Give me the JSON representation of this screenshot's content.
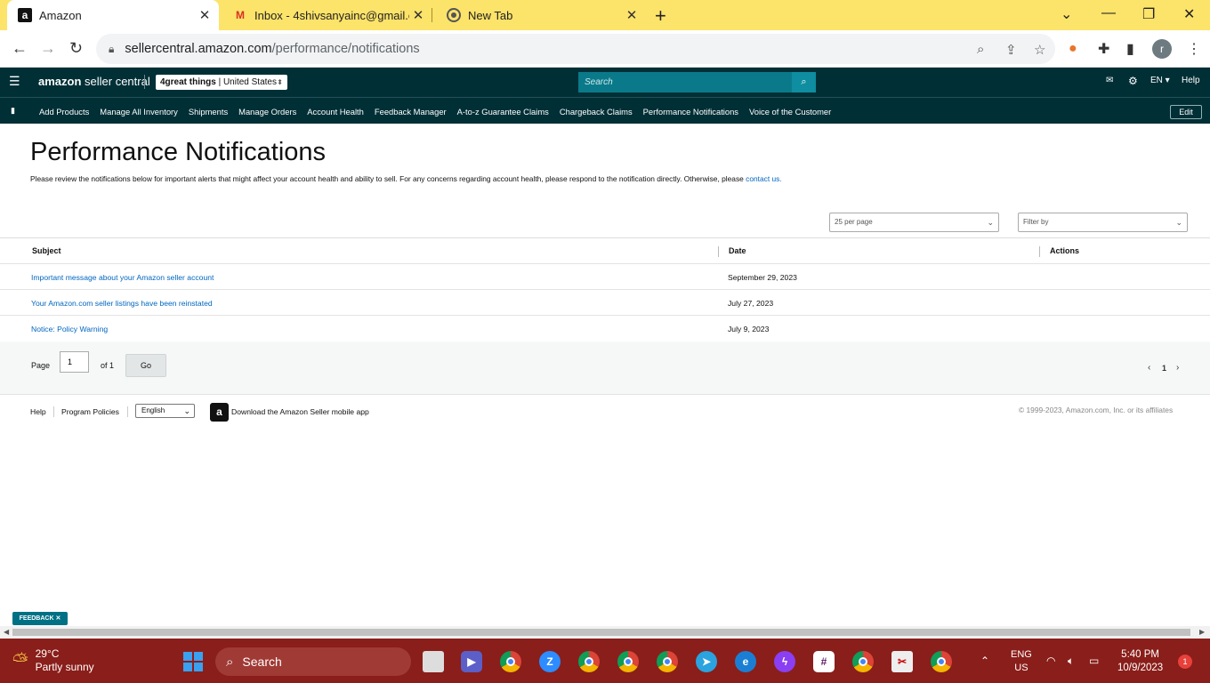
{
  "browser": {
    "tabs": [
      {
        "title": "Amazon",
        "favicon": "a"
      },
      {
        "title": "Inbox - 4shivsanyainc@gmail.co",
        "favicon": "M"
      },
      {
        "title": "New Tab",
        "favicon": "chrome"
      }
    ],
    "url_host": "sellercentral.amazon.com",
    "url_path": "/performance/notifications",
    "profile_initial": "r"
  },
  "header": {
    "logo_amazon": "amazon",
    "logo_rest": " seller central",
    "store_name": "4great things",
    "store_region": "United States",
    "search_placeholder": "Search",
    "lang": "EN",
    "help": "Help"
  },
  "nav": {
    "items": [
      "Add Products",
      "Manage All Inventory",
      "Shipments",
      "Manage Orders",
      "Account Health",
      "Feedback Manager",
      "A-to-z Guarantee Claims",
      "Chargeback Claims",
      "Performance Notifications",
      "Voice of the Customer"
    ],
    "edit": "Edit"
  },
  "page": {
    "title": "Performance Notifications",
    "intro": "Please review the notifications below for important alerts that might affect your account health and ability to sell. For any concerns regarding account health, please respond to the notification directly. Otherwise, please ",
    "contact_link": "contact us.",
    "per_page": "25 per page",
    "filter_placeholder": "Filter by"
  },
  "table": {
    "headers": {
      "subject": "Subject",
      "date": "Date",
      "actions": "Actions"
    },
    "rows": [
      {
        "subject": "Important message about your Amazon seller account",
        "date": "September 29, 2023"
      },
      {
        "subject": "Your Amazon.com seller listings have been reinstated",
        "date": "July 27, 2023"
      },
      {
        "subject": "Notice: Policy Warning",
        "date": "July 9, 2023"
      }
    ]
  },
  "pager": {
    "page_label": "Page",
    "page_value": "1",
    "of_label": "of 1",
    "go": "Go",
    "current": "1"
  },
  "footer": {
    "help": "Help",
    "policies": "Program Policies",
    "language": "English",
    "app_text": "Download the Amazon Seller mobile app",
    "copyright": "© 1999-2023, Amazon.com, Inc. or its affiliates"
  },
  "feedback": "FEEDBACK ✕",
  "taskbar": {
    "temp": "29°C",
    "weather": "Partly sunny",
    "search": "Search",
    "lang1": "ENG",
    "lang2": "US",
    "time": "5:40 PM",
    "date": "10/9/2023",
    "notifications": "1"
  },
  "colors": {
    "header_bg": "#002f36",
    "link": "#0066c0",
    "tabstrip": "#fce36a",
    "taskbar": "#8a1e1a"
  }
}
